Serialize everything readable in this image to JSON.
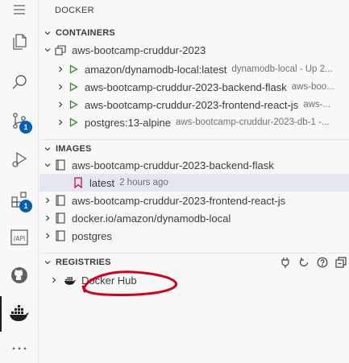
{
  "sidebar": {
    "title": "DOCKER"
  },
  "activity_bar": {
    "items": [
      {
        "icon": "menu-icon"
      },
      {
        "icon": "explorer-icon"
      },
      {
        "icon": "search-icon"
      },
      {
        "icon": "source-control-icon",
        "badge": "1"
      },
      {
        "icon": "run-debug-icon"
      },
      {
        "icon": "extensions-icon",
        "badge": "1"
      },
      {
        "icon": "api-icon",
        "label": "/API"
      },
      {
        "icon": "github-icon"
      },
      {
        "icon": "docker-icon"
      },
      {
        "icon": "more-icon"
      }
    ]
  },
  "containers": {
    "header": "CONTAINERS",
    "group": "aws-bootcamp-cruddur-2023",
    "items": [
      {
        "name": "amazon/dynamodb-local:latest",
        "desc": "dynamodb-local - Up 2..."
      },
      {
        "name": "aws-bootcamp-cruddur-2023-backend-flask",
        "desc": "aws-boo..."
      },
      {
        "name": "aws-bootcamp-cruddur-2023-frontend-react-js",
        "desc": "aws-..."
      },
      {
        "name": "postgres:13-alpine",
        "desc": "aws-bootcamp-cruddur-2023-db-1 -..."
      }
    ]
  },
  "images": {
    "header": "IMAGES",
    "items": [
      {
        "name": "aws-bootcamp-cruddur-2023-backend-flask",
        "expanded": true,
        "children": [
          {
            "name": "latest",
            "desc": "2 hours ago"
          }
        ]
      },
      {
        "name": "aws-bootcamp-cruddur-2023-frontend-react-js"
      },
      {
        "name": "docker.io/amazon/dynamodb-local"
      },
      {
        "name": "postgres"
      }
    ]
  },
  "registries": {
    "header": "REGISTRIES",
    "items": [
      {
        "name": "Docker Hub"
      }
    ],
    "toolbar": [
      "plug-icon",
      "refresh-icon",
      "help-icon",
      "collapse-all-icon"
    ]
  },
  "colors": {
    "running": "#388a34",
    "badge": "#005fb8",
    "annotation": "#d0021b"
  }
}
